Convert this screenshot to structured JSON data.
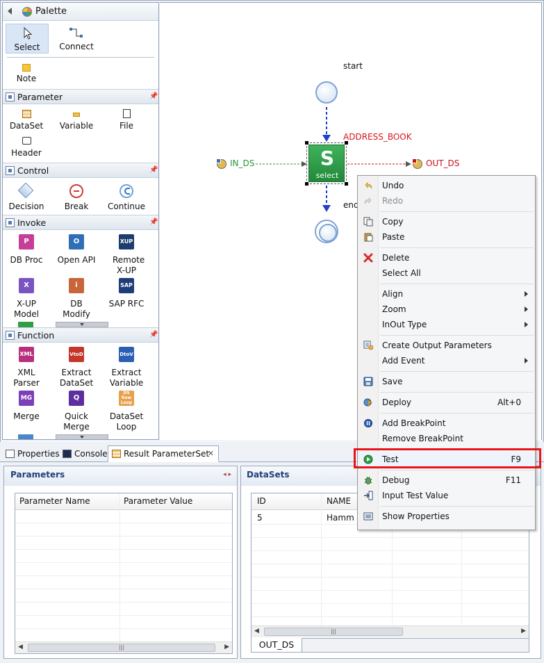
{
  "palette": {
    "title": "Palette",
    "tools": {
      "select": "Select",
      "connect": "Connect",
      "note": "Note"
    },
    "sections": [
      {
        "id": "parameter",
        "title": "Parameter",
        "items": [
          "DataSet",
          "Variable",
          "File",
          "Header"
        ]
      },
      {
        "id": "control",
        "title": "Control",
        "items": [
          "Decision",
          "Break",
          "Continue"
        ]
      },
      {
        "id": "invoke",
        "title": "Invoke",
        "items": [
          "DB Proc",
          "Open API",
          "Remote X-UP",
          "X-UP Model",
          "DB Modify",
          "SAP RFC"
        ],
        "icon_text": {
          "dbproc": "P",
          "openapi": "O",
          "remote": "XUP",
          "xupmodel": "X",
          "dbmodify": "i",
          "sap": "SAP"
        }
      },
      {
        "id": "function",
        "title": "Function",
        "items": [
          "XML Parser",
          "Extract DataSet",
          "Extract Variable",
          "Merge",
          "Quick Merge",
          "DataSet Loop"
        ],
        "icon_text": {
          "xml": "XML",
          "vtod": "VtoD",
          "dtov": "DtoV",
          "mg": "MG",
          "q": "Q",
          "loop": "DS Row Loop"
        }
      }
    ]
  },
  "canvas": {
    "start_label": "start",
    "end_label": "end",
    "node_title": "ADDRESS_BOOK",
    "node_letter": "S",
    "node_sub": "select",
    "in_label": "IN_DS",
    "out_label": "OUT_DS",
    "colors": {
      "node_fill": "#2e9c44",
      "title": "#d9141c",
      "in_line": "#27963a",
      "out_line": "#c8111a",
      "flow": "#1f3fcf"
    }
  },
  "bottom": {
    "tabs": [
      "Properties",
      "Console",
      "Result ParameterSet"
    ],
    "parameters": {
      "title": "Parameters",
      "columns": [
        "Parameter Name",
        "Parameter Value"
      ]
    },
    "datasets": {
      "title": "DataSets",
      "columns": [
        "ID",
        "NAME"
      ],
      "rows": [
        [
          "5",
          "Hamm"
        ]
      ],
      "tab": "OUT_DS"
    }
  },
  "context_menu": {
    "items": [
      {
        "label": "Undo",
        "icon": "undo-icon"
      },
      {
        "label": "Redo",
        "icon": "redo-icon",
        "disabled": true
      },
      {
        "label": "Copy",
        "icon": "copy-icon"
      },
      {
        "label": "Paste",
        "icon": "paste-icon"
      },
      {
        "label": "Delete",
        "icon": "delete-icon"
      },
      {
        "label": "Select All"
      },
      {
        "label": "Align",
        "submenu": true
      },
      {
        "label": "Zoom",
        "submenu": true
      },
      {
        "label": "InOut Type",
        "submenu": true
      },
      {
        "label": "Create Output Parameters",
        "icon": "output-params-icon"
      },
      {
        "label": "Add Event",
        "submenu": true
      },
      {
        "label": "Save",
        "icon": "save-icon"
      },
      {
        "label": "Deploy",
        "icon": "deploy-icon",
        "shortcut": "Alt+0"
      },
      {
        "label": "Add BreakPoint",
        "icon": "breakpoint-icon"
      },
      {
        "label": "Remove BreakPoint"
      },
      {
        "label": "Test",
        "icon": "test-icon",
        "shortcut": "F9",
        "highlighted": true
      },
      {
        "label": "Debug",
        "icon": "debug-icon",
        "shortcut": "F11"
      },
      {
        "label": "Input Test Value",
        "icon": "input-value-icon"
      },
      {
        "label": "Show Properties",
        "icon": "properties-icon"
      }
    ],
    "highlight_color": "#e8141c"
  }
}
